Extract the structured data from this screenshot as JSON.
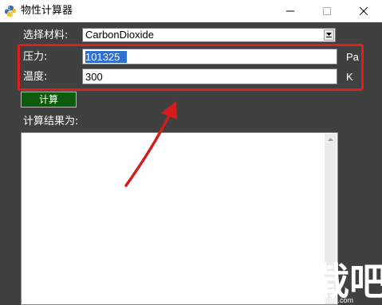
{
  "window": {
    "title": "物性计算器"
  },
  "form": {
    "material_label": "选择材料:",
    "material_value": "CarbonDioxide",
    "pressure_label": "压力:",
    "pressure_value": "101325",
    "pressure_unit": "Pa",
    "temperature_label": "温度:",
    "temperature_value": "300",
    "temperature_unit": "K"
  },
  "actions": {
    "calculate_label": "计算"
  },
  "result": {
    "label": "计算结果为:",
    "content": ""
  },
  "watermark": {
    "brand": "下载吧",
    "url": "www.xiazaiba.com"
  },
  "colors": {
    "background": "#404040",
    "button": "#0d5c0d",
    "annotation": "#e01e1e",
    "selection": "#2f6fcf"
  }
}
